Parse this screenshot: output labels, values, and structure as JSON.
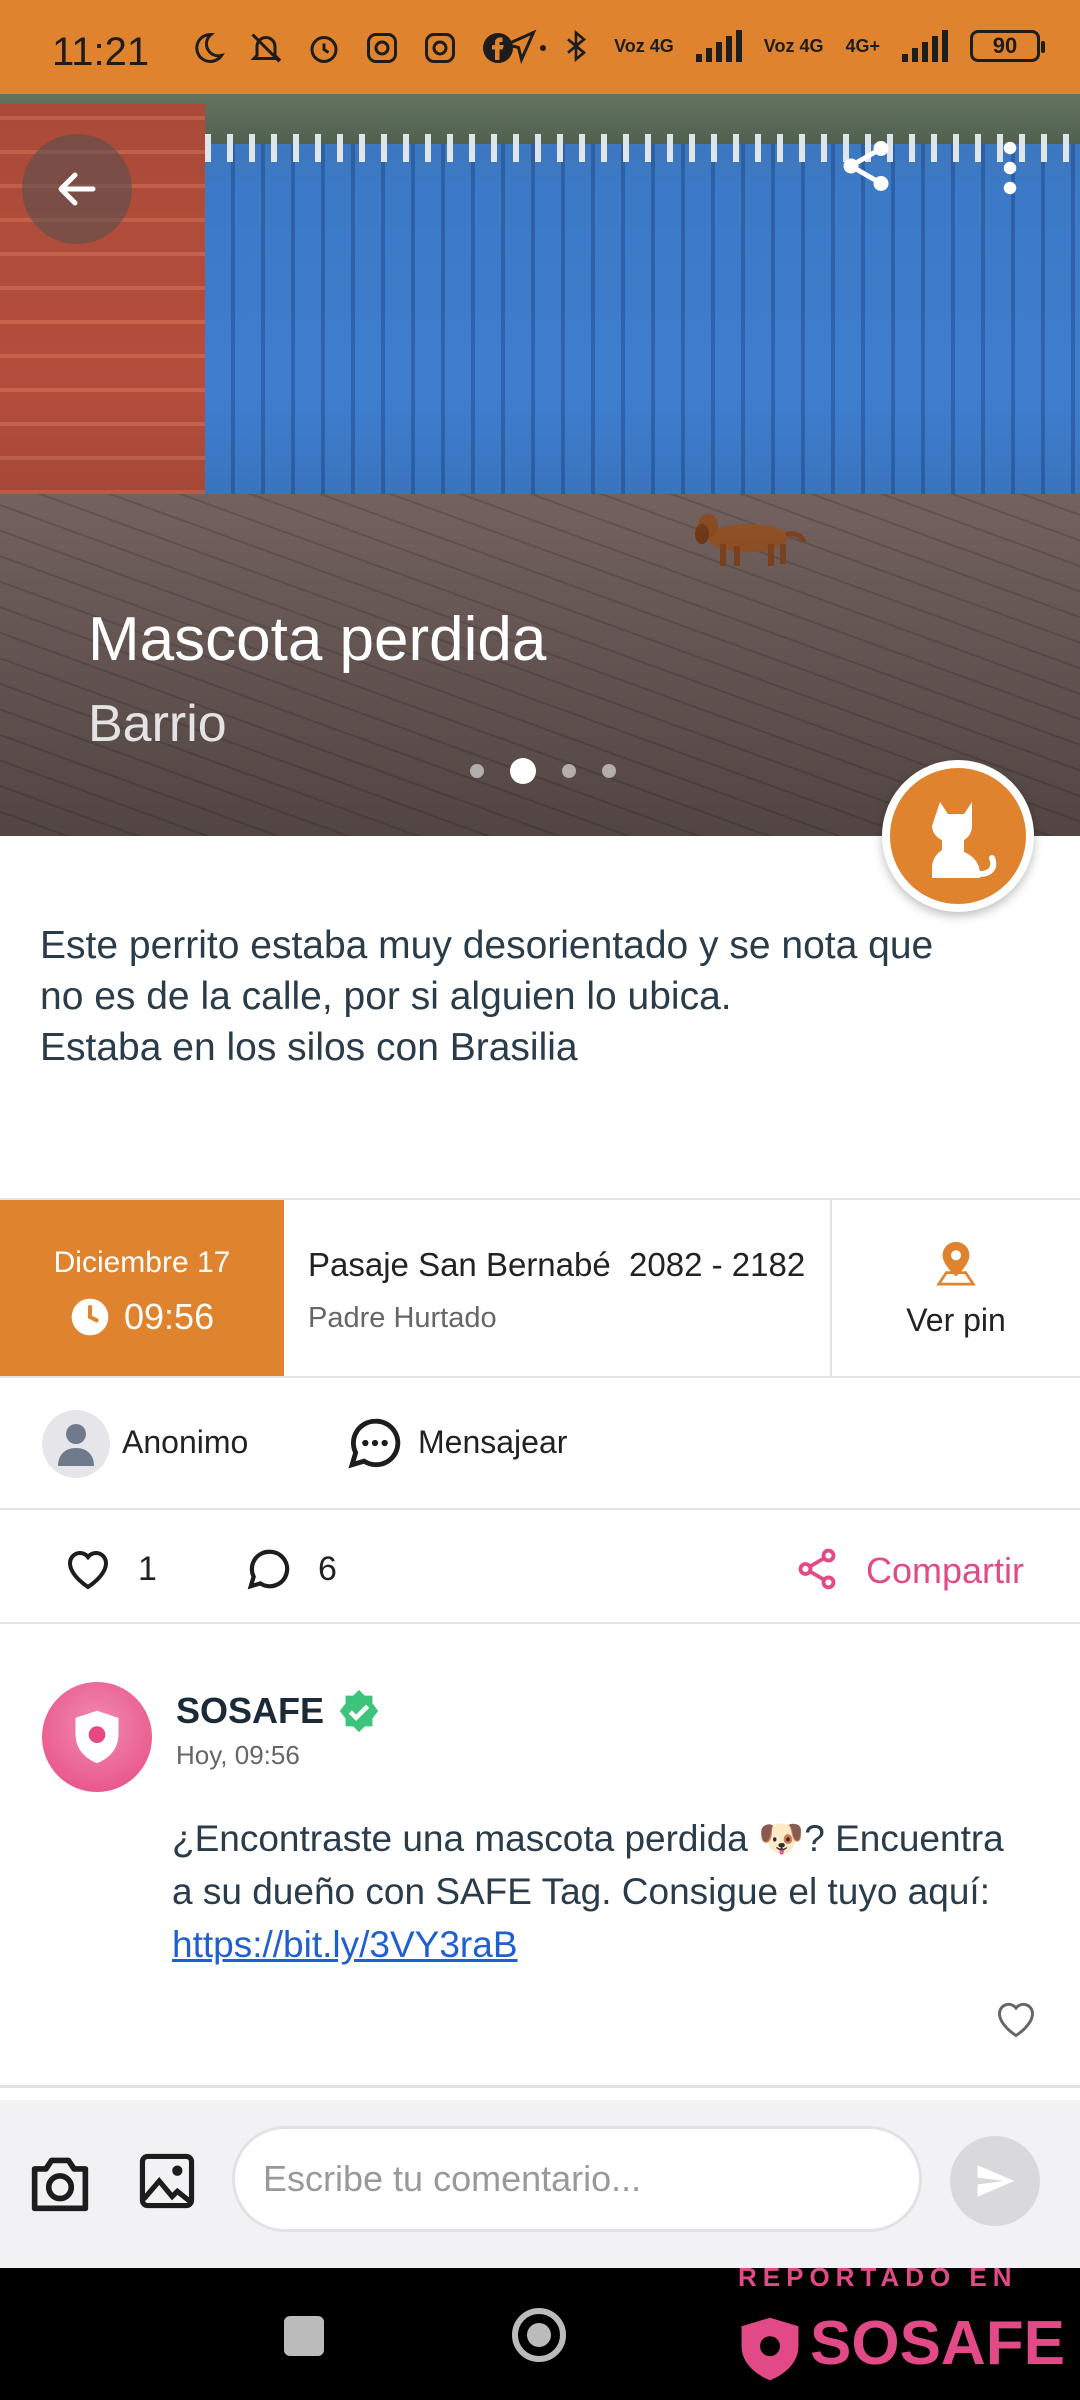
{
  "status_bar": {
    "time": "11:21",
    "network_labels": [
      "Voz 4G",
      "Voz 4G",
      "4G+"
    ],
    "battery": "90"
  },
  "hero": {
    "title": "Mascota perdida",
    "subtitle": "Barrio",
    "carousel": {
      "total": 4,
      "active_index": 1
    }
  },
  "description": "Este perrito estaba muy desorientado y se nota que\nno es de la calle, por si alguien lo ubica.\nEstaba en los silos con Brasilia",
  "info": {
    "date": "Diciembre 17",
    "time": "09:56",
    "address_line1": "Pasaje San Bernabé  2082 - 2182",
    "address_line2": "Padre Hurtado",
    "pin_label": "Ver pin"
  },
  "user": {
    "name": "Anonimo",
    "message_label": "Mensajear"
  },
  "stats": {
    "likes": "1",
    "comments": "6",
    "share_label": "Compartir"
  },
  "comment": {
    "author": "SOSAFE",
    "time": "Hoy, 09:56",
    "text_before": "¿Encontraste una mascota perdida 🐶? Encuentra a su dueño con SAFE Tag. Consigue el tuyo aquí: ",
    "link": "https://bit.ly/3VY3raB"
  },
  "composer": {
    "placeholder": "Escribe tu comentario..."
  },
  "watermark": {
    "top": "REPORTADO EN",
    "brand": "SOSAFE"
  },
  "colors": {
    "accent_orange": "#e0832e",
    "brand_pink": "#e14a86",
    "verified_green": "#3cc47c",
    "link_blue": "#1f5fcf"
  },
  "icons": [
    "back-arrow-icon",
    "share-icon",
    "more-vert-icon",
    "dog-icon",
    "clock-icon",
    "location-pin-icon",
    "person-icon",
    "chat-bubble-icon",
    "heart-icon",
    "comment-icon",
    "camera-icon",
    "image-icon",
    "send-icon",
    "verified-icon"
  ]
}
